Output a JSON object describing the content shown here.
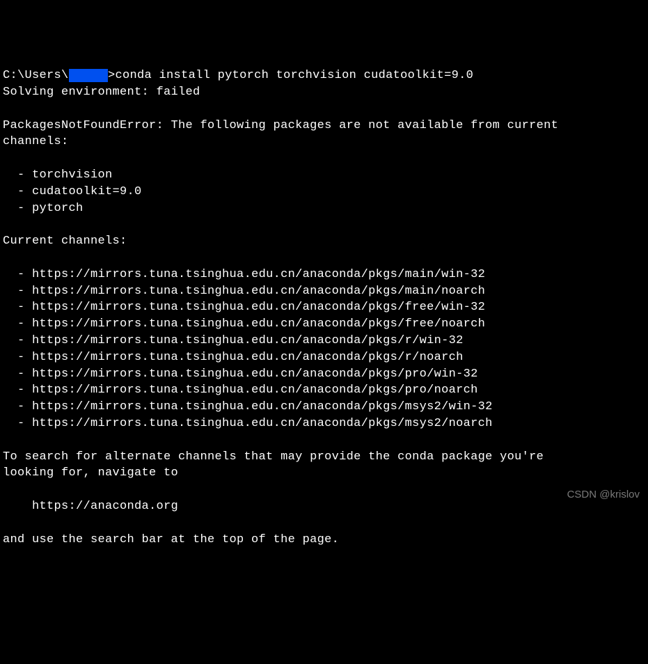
{
  "prompt": {
    "path_prefix": "C:\\Users\\",
    "redacted_user": "IIIII",
    "path_suffix": ">",
    "command": "conda install pytorch torchvision cudatoolkit=9.0"
  },
  "solving_line": "Solving environment: failed",
  "error_header": "PackagesNotFoundError: The following packages are not available from current",
  "error_header2": "channels:",
  "missing_packages": [
    "torchvision",
    "cudatoolkit=9.0",
    "pytorch"
  ],
  "current_channels_label": "Current channels:",
  "channels": [
    "https://mirrors.tuna.tsinghua.edu.cn/anaconda/pkgs/main/win-32",
    "https://mirrors.tuna.tsinghua.edu.cn/anaconda/pkgs/main/noarch",
    "https://mirrors.tuna.tsinghua.edu.cn/anaconda/pkgs/free/win-32",
    "https://mirrors.tuna.tsinghua.edu.cn/anaconda/pkgs/free/noarch",
    "https://mirrors.tuna.tsinghua.edu.cn/anaconda/pkgs/r/win-32",
    "https://mirrors.tuna.tsinghua.edu.cn/anaconda/pkgs/r/noarch",
    "https://mirrors.tuna.tsinghua.edu.cn/anaconda/pkgs/pro/win-32",
    "https://mirrors.tuna.tsinghua.edu.cn/anaconda/pkgs/pro/noarch",
    "https://mirrors.tuna.tsinghua.edu.cn/anaconda/pkgs/msys2/win-32",
    "https://mirrors.tuna.tsinghua.edu.cn/anaconda/pkgs/msys2/noarch"
  ],
  "footer_line1": "To search for alternate channels that may provide the conda package you're",
  "footer_line2": "looking for, navigate to",
  "footer_url": "    https://anaconda.org",
  "footer_line3": "and use the search bar at the top of the page.",
  "watermark": "CSDN @krislov"
}
